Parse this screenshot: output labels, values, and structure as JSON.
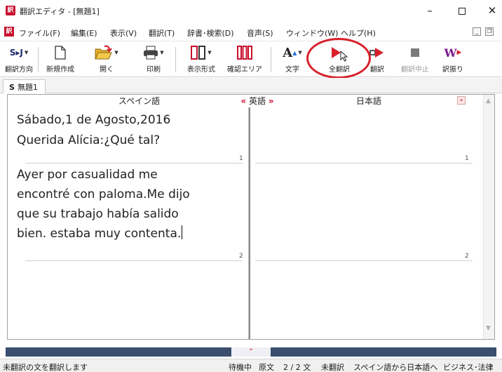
{
  "window": {
    "title": "翻訳エディタ - [無題1]",
    "app_icon": "訳",
    "minimize": "–",
    "close": "✕"
  },
  "menu": {
    "doc_icon": "訳",
    "items": [
      "ファイル(F)",
      "編集(E)",
      "表示(V)",
      "翻訳(T)",
      "辞書･検索(D)",
      "音声(S)",
      "ウィンドウ(W)",
      "ヘルプ(H)"
    ],
    "mdi_min": "_",
    "mdi_restore": "❐"
  },
  "toolbar": {
    "direction_icon": "S▸J",
    "direction": "翻訳方向",
    "new": "新規作成",
    "open": "開く",
    "print": "印刷",
    "display": "表示形式",
    "confirm": "確認エリア",
    "font_icon": "A",
    "font": "文字",
    "translate_all": "全翻訳",
    "translate": "翻訳",
    "stop": "翻訳中止",
    "assign": "訳振り",
    "word_icon": "W"
  },
  "tabs": [
    {
      "prefix": "S",
      "label": "無題1"
    }
  ],
  "editor": {
    "source_lang": "スペイン語",
    "pivot_lang": "英語",
    "target_lang": "日本語",
    "arrow_left": "«",
    "arrow_right": "»",
    "collapse": "«",
    "source_lines": [
      "Sábado,1 de Agosto,2016",
      "Querida Alícia:¿Qué tal?",
      "Ayer por casualidad me",
      "encontré con paloma.Me dijo",
      "que su trabajo había salido",
      "bien. estaba muy contenta."
    ],
    "segment_numbers": [
      "1",
      "2"
    ]
  },
  "splitter": {
    "handle": "⌃"
  },
  "status": {
    "message": "未翻訳の文を翻訳します",
    "state": "待機中",
    "mode": "原文",
    "count": "2 / 2 文",
    "trans_state": "未翻訳",
    "direction": "スペイン語から日本語へ",
    "field": "ビジネス･法律"
  },
  "colors": {
    "accent": "#d8202a",
    "splitter": "#3a4e6e"
  }
}
